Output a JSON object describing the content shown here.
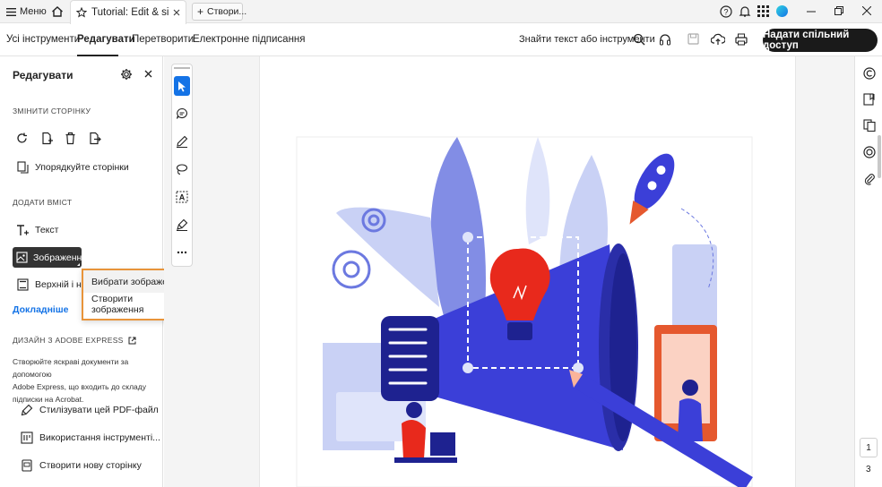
{
  "titlebar": {
    "menu_label": "Меню",
    "doc_tab_title": "Tutorial: Edit & sign ...",
    "new_tab_label": "Створи..."
  },
  "menubar": {
    "tabs": [
      "Усі інструменти",
      "Редагувати",
      "Перетворити",
      "Електронне підписання"
    ],
    "search_label": "Знайти текст або інструменти",
    "share_label": "Надати спільний доступ"
  },
  "panel": {
    "title": "Редагувати",
    "section_page": "ЗМІНИТИ СТОРІНКУ",
    "organize_label": "Упорядкуйте сторінки",
    "section_add": "ДОДАТИ ВМІСТ",
    "text_label": "Текст",
    "image_label": "Зображення",
    "header_footer_label": "Верхній і нижн",
    "more_label": "Докладніше",
    "section_express": "ДИЗАЙН З ADOBE EXPRESS",
    "express_desc": [
      "Створюйте яскраві документи за допомогою",
      "Adobe Express, що входить до складу",
      "підписки на Acrobat."
    ],
    "style_pdf_label": "Стилізувати цей PDF-файл",
    "use_tools_label": "Використання інструменті...",
    "new_page_label": "Створити нову сторінку"
  },
  "popup": {
    "items": [
      "Вибрати зображення",
      "Створити зображення"
    ]
  },
  "page_indicator": {
    "current": "1",
    "total": "3"
  },
  "colors": {
    "accent_blue": "#1473e6",
    "popup_border": "#e8943a",
    "illustration_blue": "#3b3fd8",
    "bulb_red": "#e8291c"
  }
}
